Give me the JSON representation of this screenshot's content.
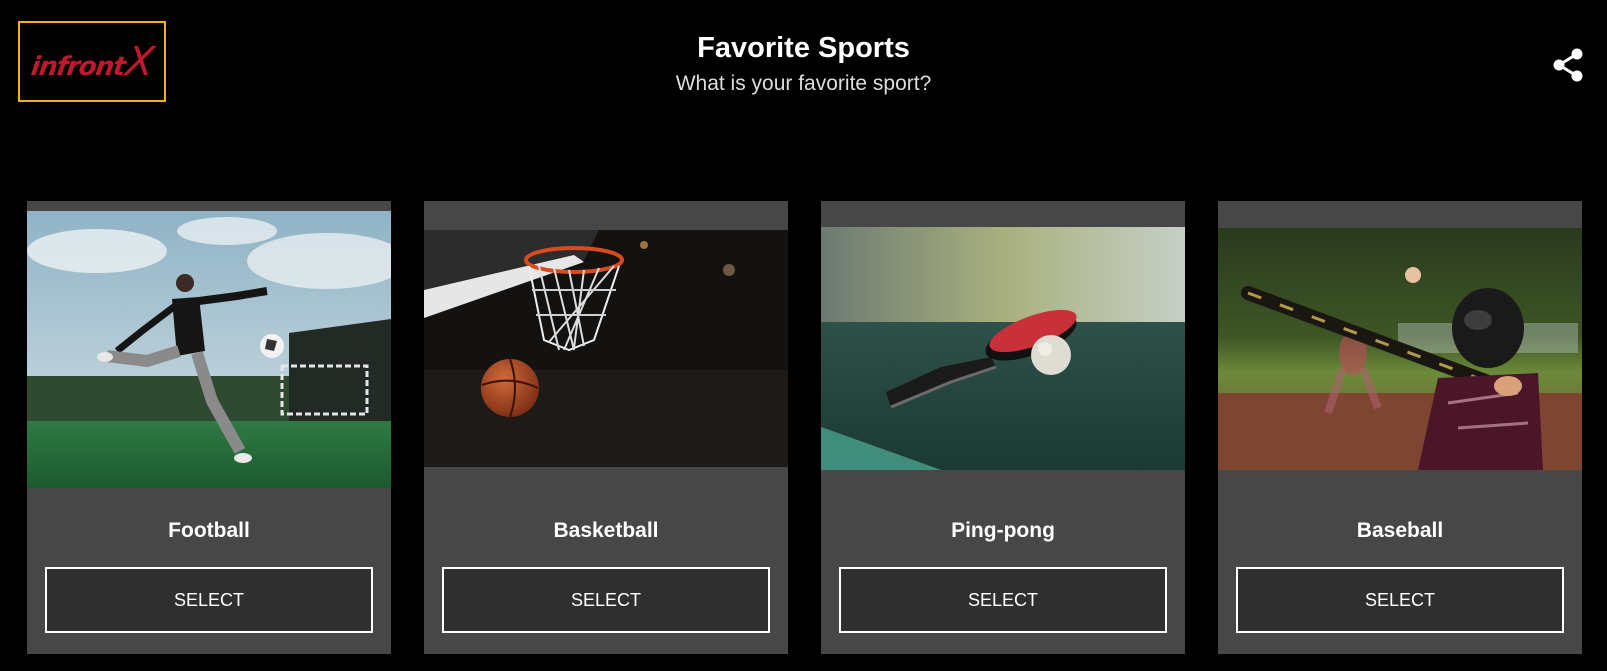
{
  "logo": {
    "text": "infront",
    "mark": "X"
  },
  "header": {
    "title": "Favorite Sports",
    "subtitle": "What is your favorite sport?"
  },
  "share_icon": "share-icon",
  "colors": {
    "accent": "#f2b01e",
    "brand": "#c3172f",
    "card": "#474747",
    "button": "#2f2f2f"
  },
  "cards": [
    {
      "name": "Football",
      "button_label": "SELECT"
    },
    {
      "name": "Basketball",
      "button_label": "SELECT"
    },
    {
      "name": "Ping-pong",
      "button_label": "SELECT"
    },
    {
      "name": "Baseball",
      "button_label": "SELECT"
    }
  ]
}
